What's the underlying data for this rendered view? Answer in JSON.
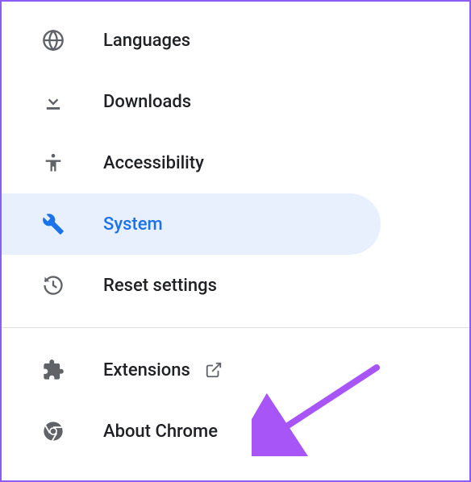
{
  "sidebar": {
    "items": [
      {
        "label": "Languages",
        "icon": "globe-icon"
      },
      {
        "label": "Downloads",
        "icon": "download-icon"
      },
      {
        "label": "Accessibility",
        "icon": "accessibility-icon"
      },
      {
        "label": "System",
        "icon": "wrench-icon",
        "selected": true
      },
      {
        "label": "Reset settings",
        "icon": "reset-icon"
      }
    ],
    "footer": [
      {
        "label": "Extensions",
        "icon": "puzzle-icon",
        "external": true
      },
      {
        "label": "About Chrome",
        "icon": "chrome-icon"
      }
    ]
  },
  "colors": {
    "selected_bg": "#e8f0fe",
    "selected_text": "#1a73e8",
    "text": "#202124",
    "icon": "#5f6368",
    "annotation_arrow": "#a855f7"
  }
}
